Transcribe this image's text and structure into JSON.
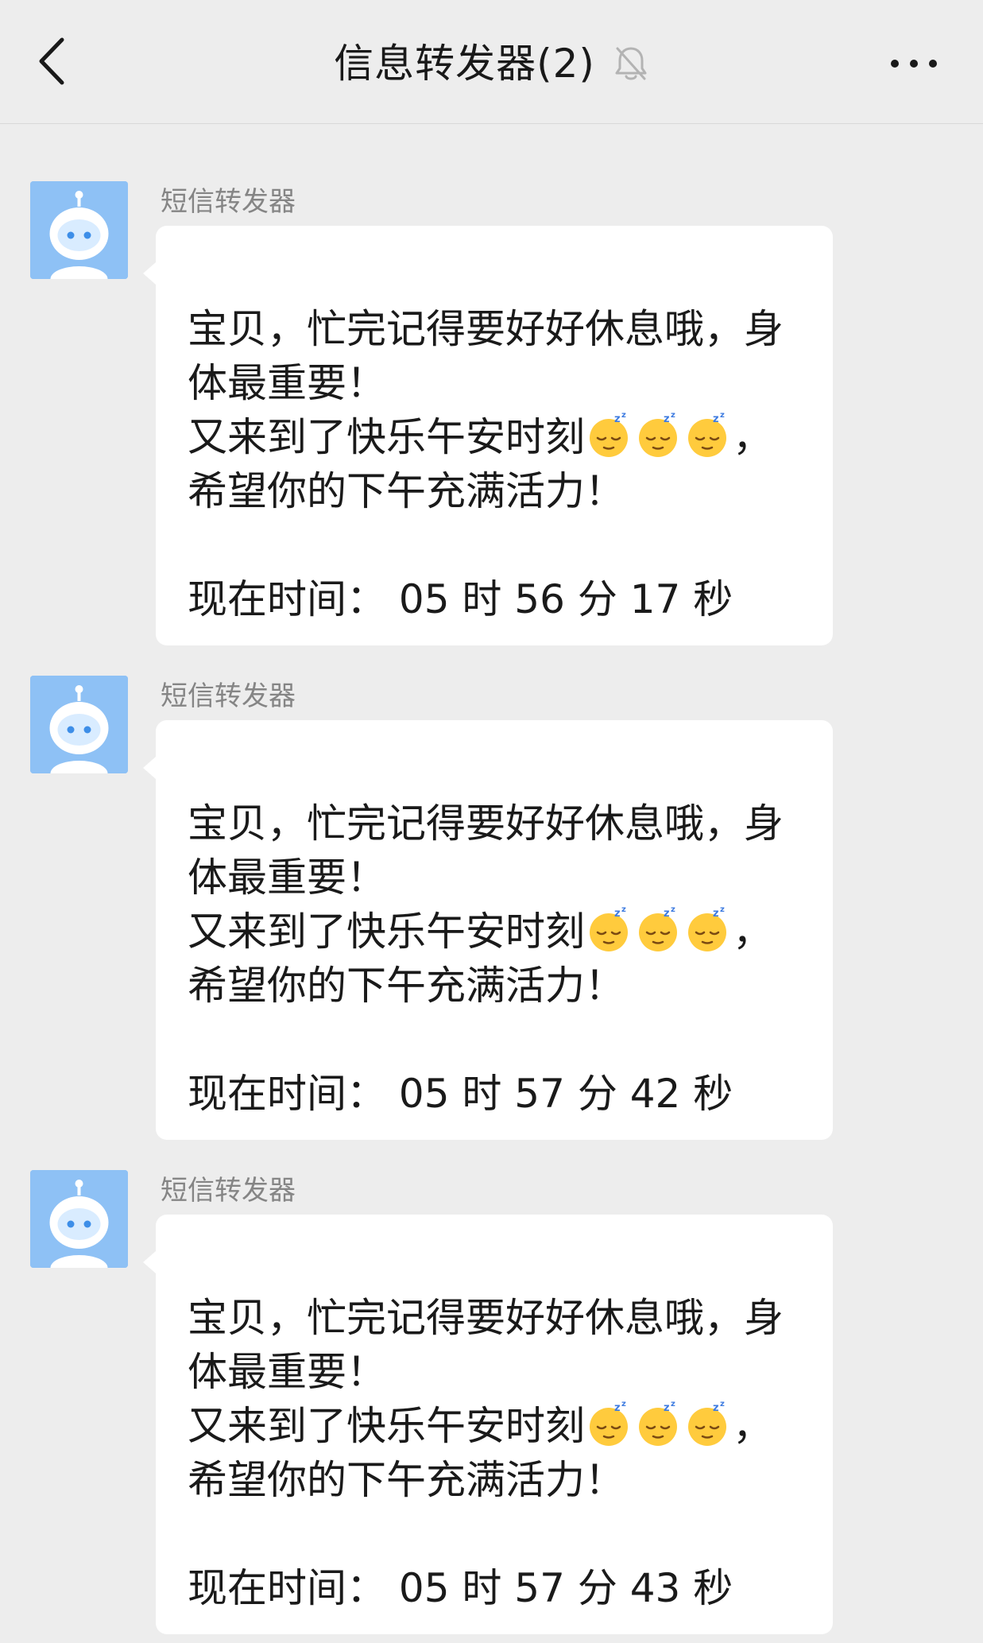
{
  "header": {
    "title": "信息转发器(2)",
    "back_icon": "chevron-left-icon",
    "mute_icon": "bell-off-icon",
    "more_icon": "more-horizontal-icon"
  },
  "messages": [
    {
      "sender": "短信转发器",
      "avatar_icon": "robot-avatar",
      "line1": "宝贝，忙完记得要好好休息哦，身",
      "line2": "体最重要！",
      "line3_text": "又来到了快乐午安时刻",
      "line3_emoji": "sleeping-face-emoji",
      "line3_tail": "，",
      "line4": "希望你的下午充满活力！",
      "time_line": "现在时间：  05 时 56 分 17 秒"
    },
    {
      "sender": "短信转发器",
      "avatar_icon": "robot-avatar",
      "line1": "宝贝，忙完记得要好好休息哦，身",
      "line2": "体最重要！",
      "line3_text": "又来到了快乐午安时刻",
      "line3_emoji": "sleeping-face-emoji",
      "line3_tail": "，",
      "line4": "希望你的下午充满活力！",
      "time_line": "现在时间：  05 时 57 分 42 秒"
    },
    {
      "sender": "短信转发器",
      "avatar_icon": "robot-avatar",
      "line1": "宝贝，忙完记得要好好休息哦，身",
      "line2": "体最重要！",
      "line3_text": "又来到了快乐午安时刻",
      "line3_emoji": "sleeping-face-emoji",
      "line3_tail": "，",
      "line4": "希望你的下午充满活力！",
      "time_line": "现在时间：  05 时 57 分 43 秒"
    }
  ],
  "colors": {
    "background": "#ededed",
    "bubble": "#ffffff",
    "text": "#1a1a1a",
    "sender": "#858585",
    "avatar": "#8ec1f5"
  }
}
